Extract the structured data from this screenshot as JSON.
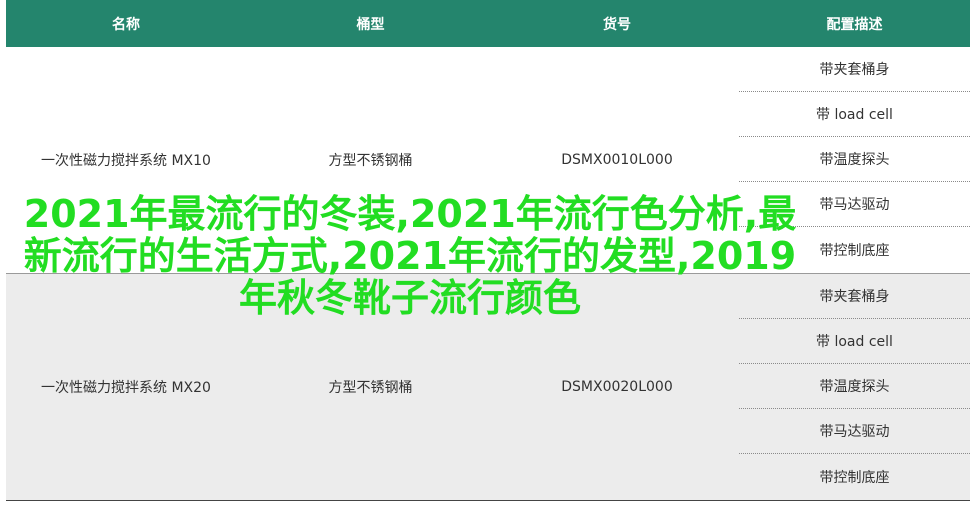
{
  "table": {
    "headers": [
      "名称",
      "桶型",
      "货号",
      "配置描述"
    ],
    "rows": [
      {
        "name": "一次性磁力搅拌系统 MX10",
        "type": "方型不锈钢桶",
        "sku": "DSMX0010L000",
        "configs": [
          "带夹套桶身",
          "带 load cell",
          "带温度探头",
          "带马达驱动",
          "带控制底座"
        ]
      },
      {
        "name": "一次性磁力搅拌系统 MX20",
        "type": "方型不锈钢桶",
        "sku": "DSMX0020L000",
        "configs": [
          "带夹套桶身",
          "带 load cell",
          "带温度探头",
          "带马达驱动",
          "带控制底座"
        ]
      }
    ]
  },
  "overlay": {
    "text": "2021年最流行的冬装,2021年流行色分析,最新流行的生活方式,2021年流行的发型,2019年秋冬靴子流行颜色"
  }
}
